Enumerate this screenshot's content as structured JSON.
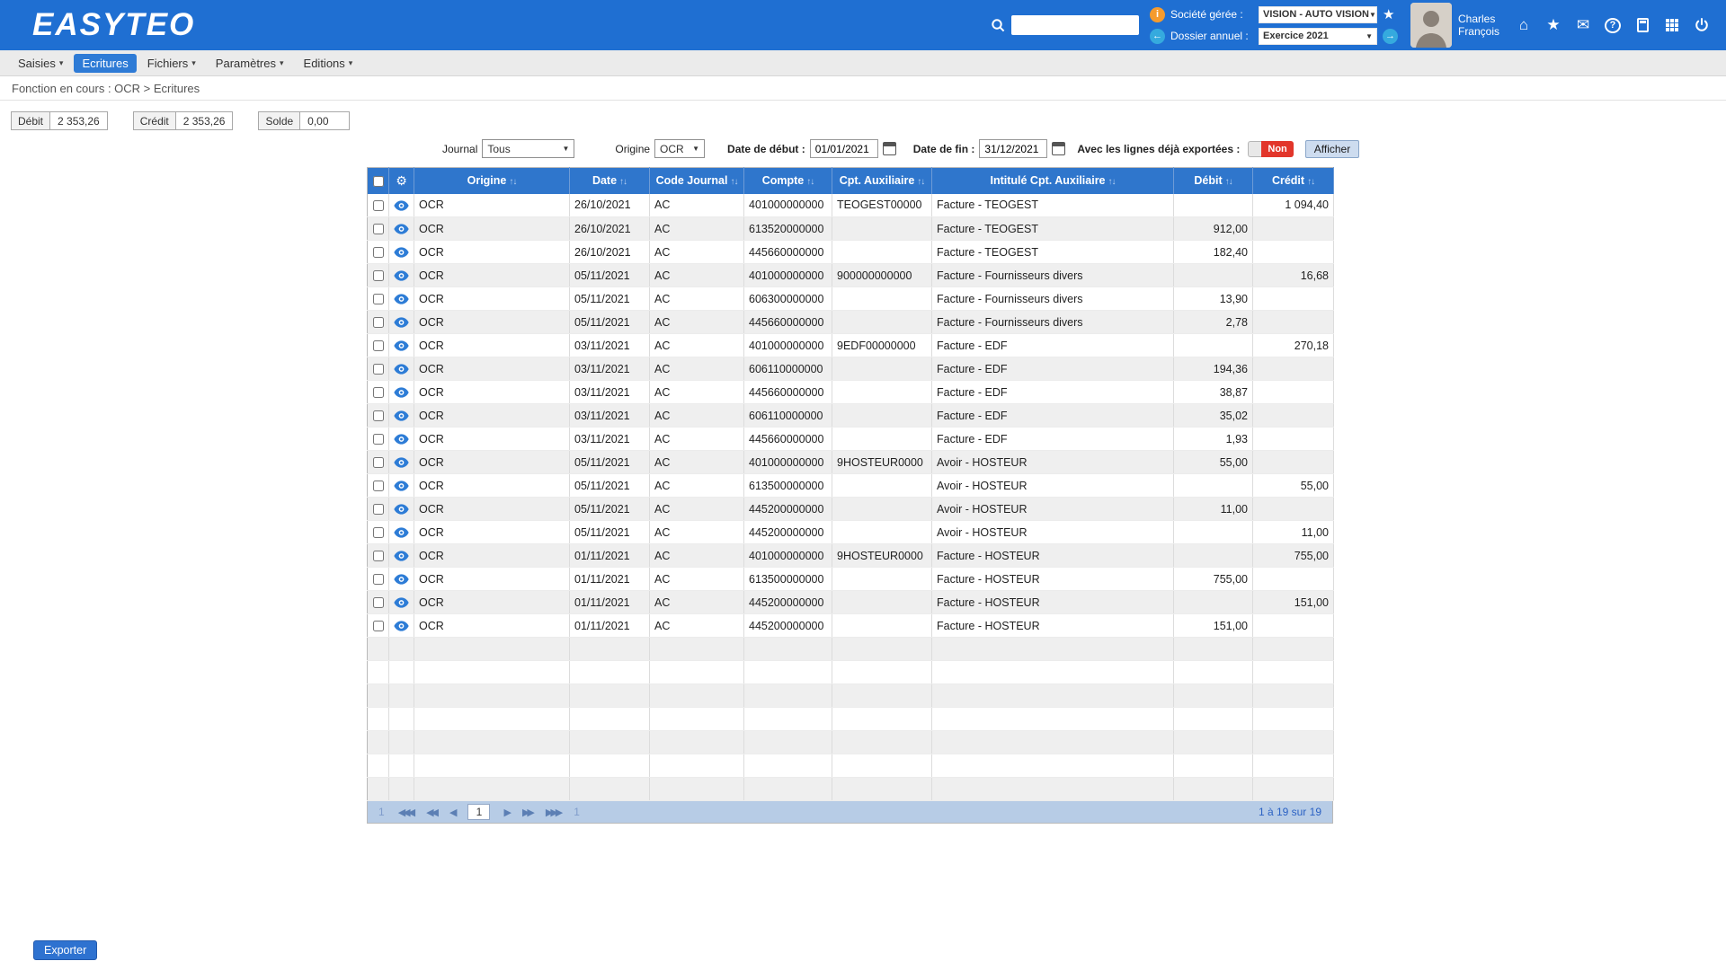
{
  "colors": {
    "header_blue": "#1f6fd2",
    "menu_active_blue": "#2e7bd6",
    "table_header_blue": "#2f76cc",
    "pagination_bg": "#b7cce6",
    "toggle_red": "#e2362b",
    "link_blue": "#2b62c4",
    "accent_orange": "#f59b2d",
    "eye_blue": "#2d7cd6"
  },
  "icons": {
    "caret": "▾",
    "chevron_down": "▼",
    "sort": "↑↓",
    "gear": "⚙",
    "home": "⌂",
    "favorites": "★",
    "mail": "✉",
    "help": "?",
    "favorite_star": "★",
    "prev_arrow": "←",
    "next_arrow": "→",
    "company_badge": "i",
    "page_first": "◀◀◀",
    "page_prev_group": "◀◀",
    "page_prev": "◀",
    "page_next": "▶",
    "page_next_group": "▶▶",
    "page_last": "▶▶▶"
  },
  "header": {
    "logo": "EASYTEO",
    "company_label": "Société gérée :",
    "company_value": "VISION - AUTO VISION",
    "folder_label": "Dossier annuel :",
    "folder_value": "Exercice 2021",
    "user_name_line1": "Charles",
    "user_name_line2": "François"
  },
  "menu": {
    "items": [
      {
        "label": "Saisies",
        "caret": true,
        "active": false
      },
      {
        "label": "Ecritures",
        "caret": false,
        "active": true
      },
      {
        "label": "Fichiers",
        "caret": true,
        "active": false
      },
      {
        "label": "Paramètres",
        "caret": true,
        "active": false
      },
      {
        "label": "Editions",
        "caret": true,
        "active": false
      }
    ]
  },
  "breadcrumb": "Fonction en cours :  OCR > Ecritures",
  "totals": {
    "debit_label": "Débit",
    "debit_value": "2 353,26",
    "credit_label": "Crédit",
    "credit_value": "2 353,26",
    "solde_label": "Solde",
    "solde_value": "0,00"
  },
  "filters": {
    "journal_label": "Journal",
    "journal_value": "Tous",
    "origine_label": "Origine",
    "origine_value": "OCR",
    "date_start_label": "Date de début :",
    "date_start_value": "01/01/2021",
    "date_end_label": "Date de fin :",
    "date_end_value": "31/12/2021",
    "exported_label": "Avec les lignes déjà exportées :",
    "toggle_value": "Non",
    "show_button": "Afficher"
  },
  "table": {
    "columns": [
      "Origine",
      "Date",
      "Code Journal",
      "Compte",
      "Cpt. Auxiliaire",
      "Intitulé Cpt. Auxiliaire",
      "Débit",
      "Crédit"
    ],
    "empty_rows": 7,
    "rows": [
      {
        "origine": "OCR",
        "date": "26/10/2021",
        "journal": "AC",
        "compte": "401000000000",
        "aux": "TEOGEST00000",
        "intitule": "Facture - TEOGEST",
        "debit": "",
        "credit": "1 094,40"
      },
      {
        "origine": "OCR",
        "date": "26/10/2021",
        "journal": "AC",
        "compte": "613520000000",
        "aux": "",
        "intitule": "Facture - TEOGEST",
        "debit": "912,00",
        "credit": ""
      },
      {
        "origine": "OCR",
        "date": "26/10/2021",
        "journal": "AC",
        "compte": "445660000000",
        "aux": "",
        "intitule": "Facture - TEOGEST",
        "debit": "182,40",
        "credit": ""
      },
      {
        "origine": "OCR",
        "date": "05/11/2021",
        "journal": "AC",
        "compte": "401000000000",
        "aux": "900000000000",
        "intitule": "Facture - Fournisseurs divers",
        "debit": "",
        "credit": "16,68"
      },
      {
        "origine": "OCR",
        "date": "05/11/2021",
        "journal": "AC",
        "compte": "606300000000",
        "aux": "",
        "intitule": "Facture - Fournisseurs divers",
        "debit": "13,90",
        "credit": ""
      },
      {
        "origine": "OCR",
        "date": "05/11/2021",
        "journal": "AC",
        "compte": "445660000000",
        "aux": "",
        "intitule": "Facture - Fournisseurs divers",
        "debit": "2,78",
        "credit": ""
      },
      {
        "origine": "OCR",
        "date": "03/11/2021",
        "journal": "AC",
        "compte": "401000000000",
        "aux": "9EDF00000000",
        "intitule": "Facture - EDF",
        "debit": "",
        "credit": "270,18"
      },
      {
        "origine": "OCR",
        "date": "03/11/2021",
        "journal": "AC",
        "compte": "606110000000",
        "aux": "",
        "intitule": "Facture - EDF",
        "debit": "194,36",
        "credit": ""
      },
      {
        "origine": "OCR",
        "date": "03/11/2021",
        "journal": "AC",
        "compte": "445660000000",
        "aux": "",
        "intitule": "Facture - EDF",
        "debit": "38,87",
        "credit": ""
      },
      {
        "origine": "OCR",
        "date": "03/11/2021",
        "journal": "AC",
        "compte": "606110000000",
        "aux": "",
        "intitule": "Facture - EDF",
        "debit": "35,02",
        "credit": ""
      },
      {
        "origine": "OCR",
        "date": "03/11/2021",
        "journal": "AC",
        "compte": "445660000000",
        "aux": "",
        "intitule": "Facture - EDF",
        "debit": "1,93",
        "credit": ""
      },
      {
        "origine": "OCR",
        "date": "05/11/2021",
        "journal": "AC",
        "compte": "401000000000",
        "aux": "9HOSTEUR0000",
        "intitule": "Avoir - HOSTEUR",
        "debit": "55,00",
        "credit": ""
      },
      {
        "origine": "OCR",
        "date": "05/11/2021",
        "journal": "AC",
        "compte": "613500000000",
        "aux": "",
        "intitule": "Avoir - HOSTEUR",
        "debit": "",
        "credit": "55,00"
      },
      {
        "origine": "OCR",
        "date": "05/11/2021",
        "journal": "AC",
        "compte": "445200000000",
        "aux": "",
        "intitule": "Avoir - HOSTEUR",
        "debit": "11,00",
        "credit": ""
      },
      {
        "origine": "OCR",
        "date": "05/11/2021",
        "journal": "AC",
        "compte": "445200000000",
        "aux": "",
        "intitule": "Avoir - HOSTEUR",
        "debit": "",
        "credit": "11,00"
      },
      {
        "origine": "OCR",
        "date": "01/11/2021",
        "journal": "AC",
        "compte": "401000000000",
        "aux": "9HOSTEUR0000",
        "intitule": "Facture - HOSTEUR",
        "debit": "",
        "credit": "755,00"
      },
      {
        "origine": "OCR",
        "date": "01/11/2021",
        "journal": "AC",
        "compte": "613500000000",
        "aux": "",
        "intitule": "Facture - HOSTEUR",
        "debit": "755,00",
        "credit": ""
      },
      {
        "origine": "OCR",
        "date": "01/11/2021",
        "journal": "AC",
        "compte": "445200000000",
        "aux": "",
        "intitule": "Facture - HOSTEUR",
        "debit": "",
        "credit": "151,00"
      },
      {
        "origine": "OCR",
        "date": "01/11/2021",
        "journal": "AC",
        "compte": "445200000000",
        "aux": "",
        "intitule": "Facture - HOSTEUR",
        "debit": "151,00",
        "credit": ""
      }
    ]
  },
  "pagination": {
    "first_label": "1",
    "current": "1",
    "last_label": "1",
    "summary": "1 à 19 sur 19"
  },
  "footer": {
    "export_button": "Exporter"
  }
}
